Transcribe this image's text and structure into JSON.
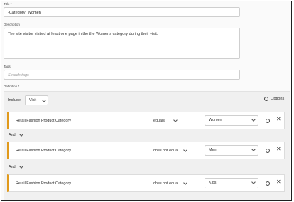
{
  "title_field": {
    "label": "Title *",
    "value": "-Category: Women"
  },
  "description_field": {
    "label": "Description",
    "value": "The site visitor visited at least one page in the the Womens category during their visit."
  },
  "tags_field": {
    "label": "Tags",
    "placeholder": "Search tags"
  },
  "definition": {
    "label": "Definition *",
    "include_label": "Include",
    "include_value": "Visit",
    "options_label": "Options",
    "rules": [
      {
        "dimension": "Retail Fashion Product Category",
        "operator": "equals",
        "value": "Women"
      },
      {
        "dimension": "Retail Fashion Product Category",
        "operator": "does not equal",
        "value": "Men"
      },
      {
        "dimension": "Retail Fashion Product Category",
        "operator": "does not equal",
        "value": "Kids"
      }
    ],
    "connectors": [
      "And",
      "And"
    ]
  },
  "colors": {
    "rule_accent": "#e19a1c"
  },
  "icons": [
    "gear-icon",
    "close-icon",
    "chevron-down-icon"
  ]
}
